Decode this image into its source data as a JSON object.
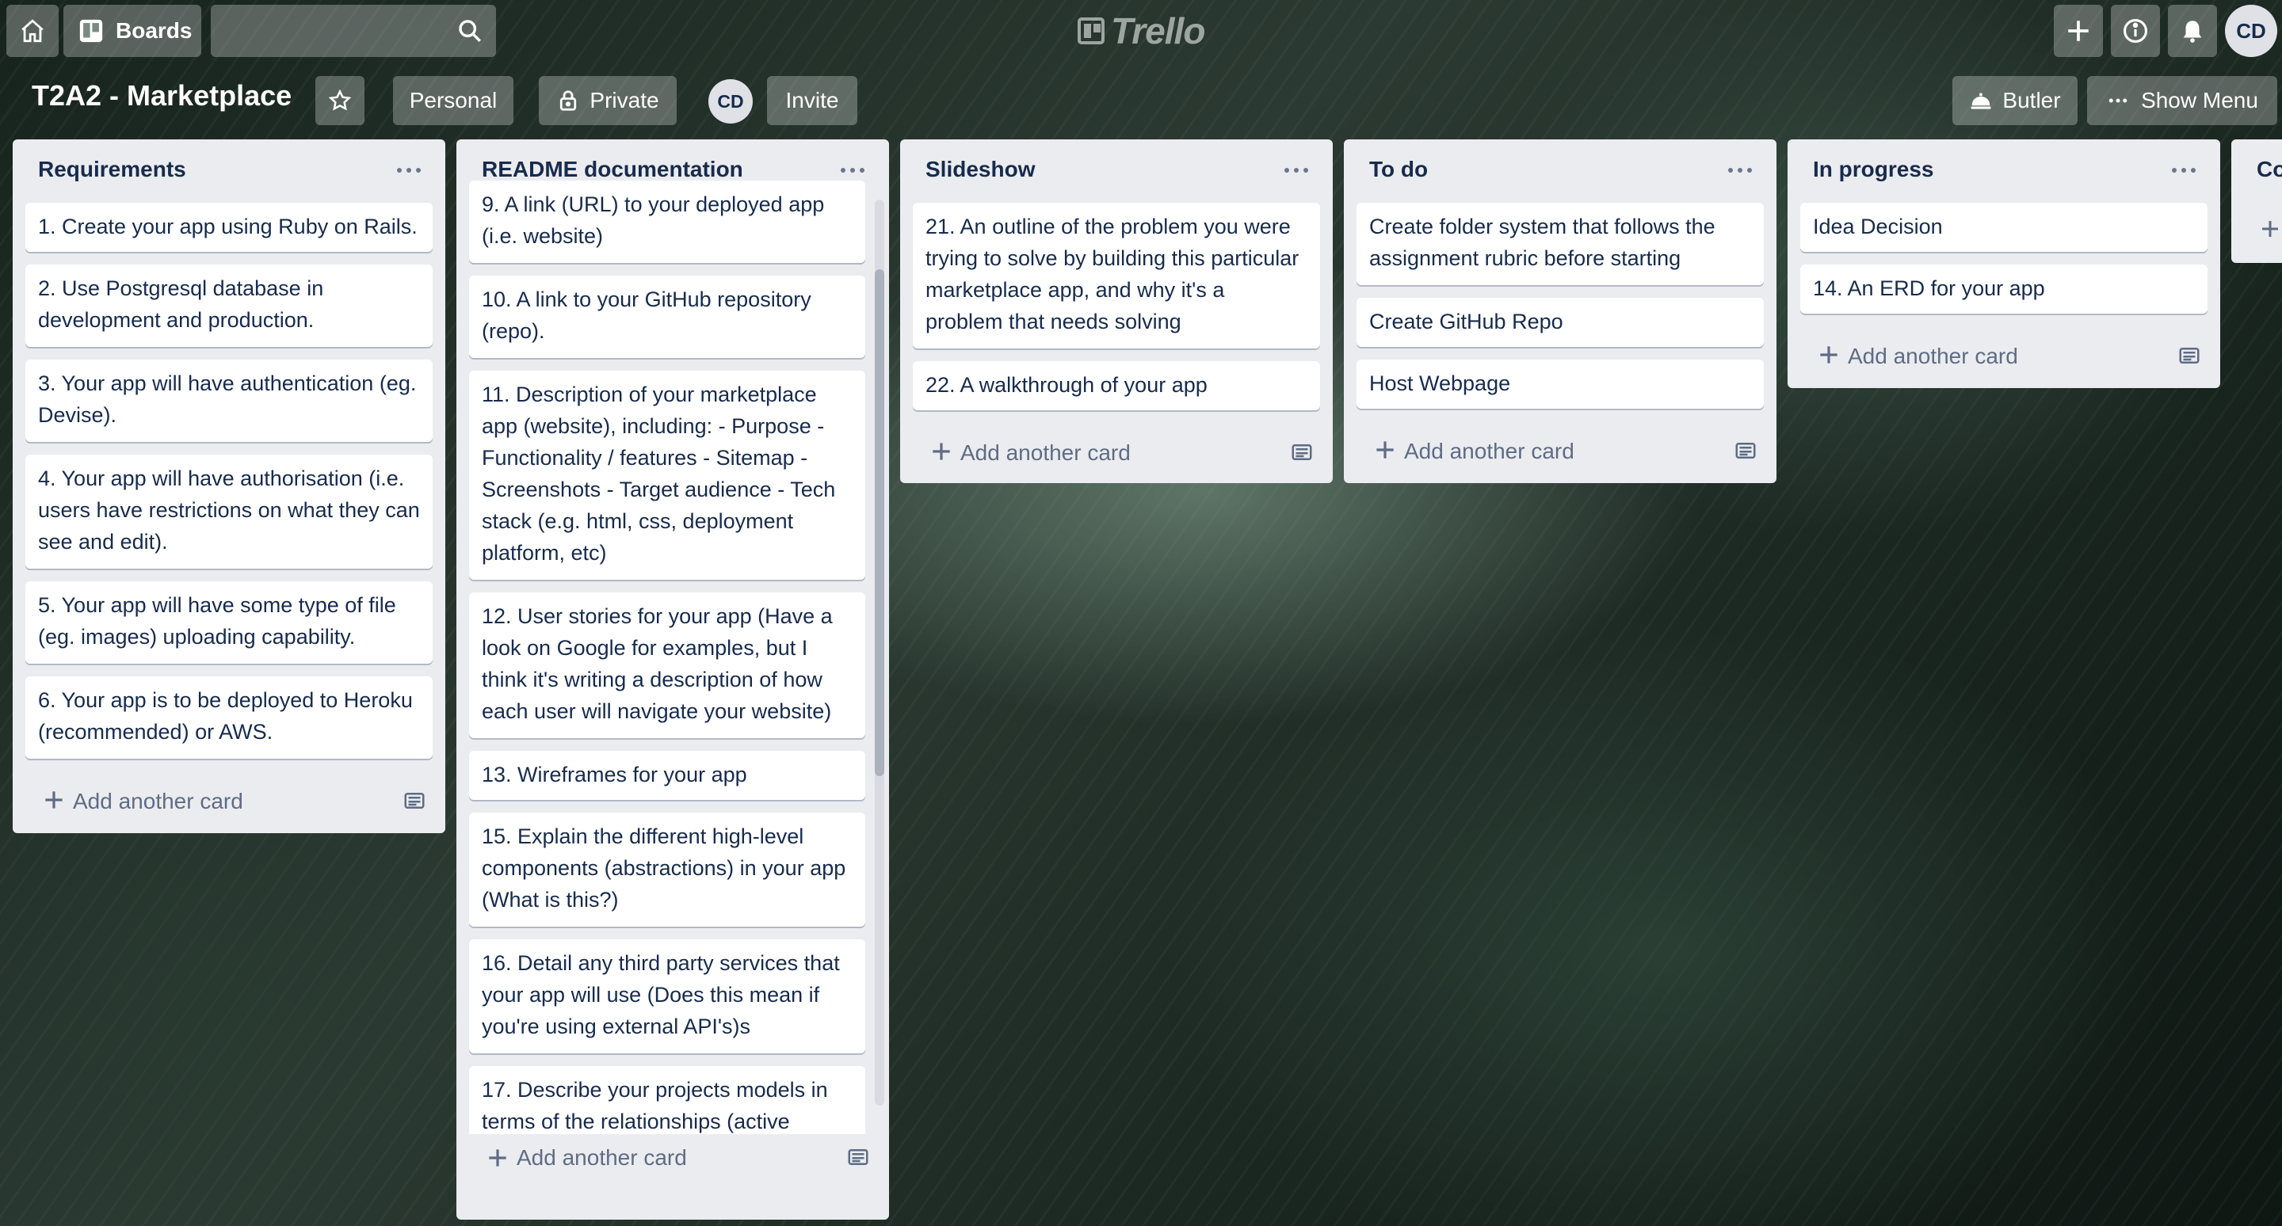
{
  "topbar": {
    "home_icon": "home-icon",
    "boards_label": "Boards",
    "search_placeholder": "",
    "logo_text": "Trello",
    "avatar_initials": "CD"
  },
  "board": {
    "title": "T2A2 - Marketplace",
    "team_label": "Personal",
    "visibility_label": "Private",
    "member_initials": "CD",
    "invite_label": "Invite",
    "butler_label": "Butler",
    "show_menu_label": "Show Menu"
  },
  "add_card_label": "Add another card",
  "lists": [
    {
      "title": "Requirements",
      "cards": [
        "1. Create your app using Ruby on Rails.",
        "2. Use Postgresql database in development and production.",
        "3. Your app will have authentication (eg. Devise).",
        "4. Your app will have authorisation (i.e. users have restrictions on what they can see and edit).",
        "5. Your app will have some type of file (eg. images) uploading capability.",
        "6. Your app is to be deployed to Heroku (recommended) or AWS."
      ]
    },
    {
      "title": "README documentation",
      "cards": [
        "9. A link (URL) to your deployed app (i.e. website)",
        "10. A link to your GitHub repository (repo).",
        "11. Description of your marketplace app (website), including: - Purpose - Functionality / features - Sitemap - Screenshots - Target audience - Tech stack (e.g. html, css, deployment platform, etc)",
        "12. User stories for your app (Have a look on Google for examples, but I think it's writing a description of how each user will navigate your website)",
        "13. Wireframes for your app",
        "15. Explain the different high-level components (abstractions) in your app (What is this?)",
        "16. Detail any third party services that your app will use (Does this mean if you're using external API's)s",
        "17. Describe your projects models in terms of the relationships (active"
      ]
    },
    {
      "title": "Slideshow",
      "cards": [
        "21. An outline of the problem you were trying to solve by building this particular marketplace app, and why it's a problem that needs solving",
        "22. A walkthrough of your app"
      ]
    },
    {
      "title": "To do",
      "cards": [
        "Create folder system that follows the assignment rubric before starting",
        "Create GitHub Repo",
        "Host Webpage"
      ]
    },
    {
      "title": "In progress",
      "cards": [
        "Idea Decision",
        "14. An ERD for your app"
      ]
    },
    {
      "title": "Co",
      "cards": []
    }
  ]
}
